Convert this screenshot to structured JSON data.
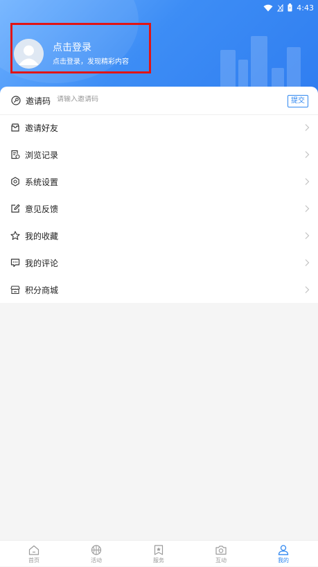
{
  "status_bar": {
    "time": "4:43"
  },
  "login": {
    "title": "点击登录",
    "subtitle": "点击登录，发现精彩内容"
  },
  "invite": {
    "label": "邀请码",
    "placeholder": "请输入邀请码",
    "submit_label": "提交"
  },
  "menu": {
    "items": [
      {
        "label": "邀请好友",
        "icon": "inbox-icon"
      },
      {
        "label": "浏览记录",
        "icon": "history-icon"
      },
      {
        "label": "系统设置",
        "icon": "gear-icon"
      },
      {
        "label": "意见反馈",
        "icon": "edit-icon"
      },
      {
        "label": "我的收藏",
        "icon": "star-icon"
      },
      {
        "label": "我的评论",
        "icon": "comment-icon"
      },
      {
        "label": "积分商城",
        "icon": "shop-icon"
      }
    ]
  },
  "tabs": [
    {
      "label": "首页",
      "icon": "home-icon",
      "active": false
    },
    {
      "label": "活动",
      "icon": "basketball-icon",
      "active": false
    },
    {
      "label": "服务",
      "icon": "bookmark-star-icon",
      "active": false
    },
    {
      "label": "互动",
      "icon": "camera-icon",
      "active": false
    },
    {
      "label": "我的",
      "icon": "user-icon",
      "active": true
    }
  ],
  "colors": {
    "accent": "#2f87f0",
    "header_gradient_start": "#6fb2ff",
    "header_gradient_end": "#2f7df0",
    "highlight_border": "#e11414"
  }
}
